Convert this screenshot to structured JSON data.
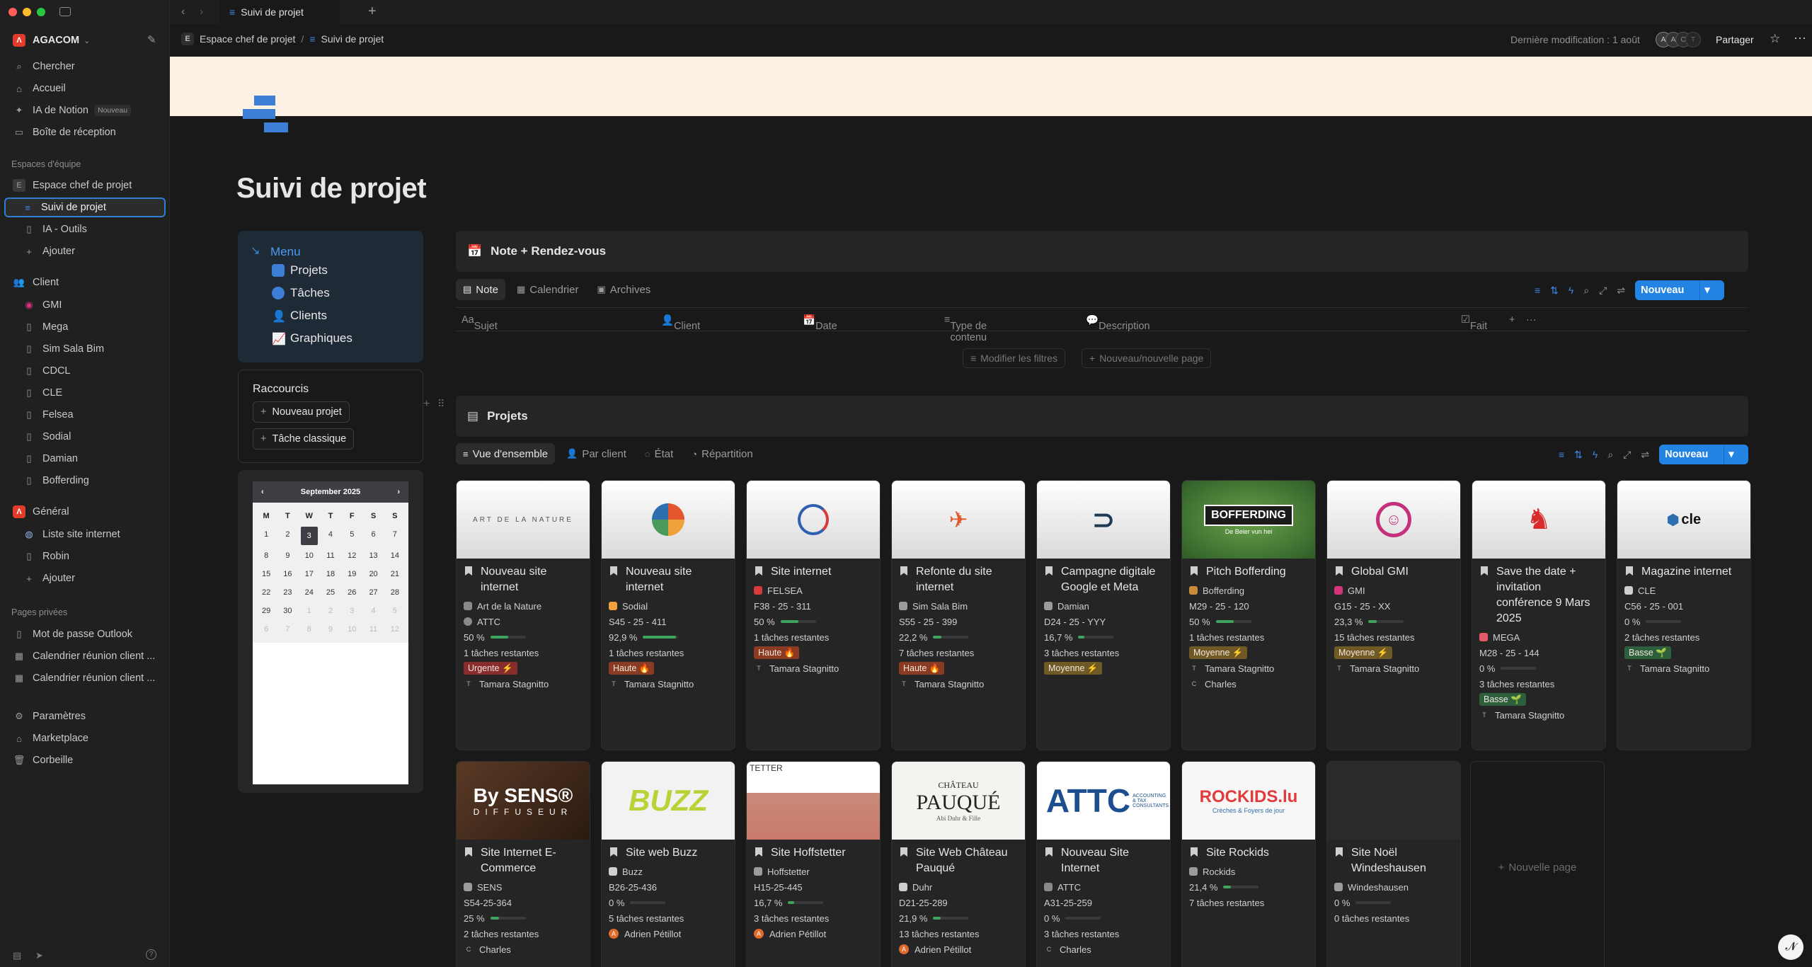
{
  "window": {
    "tab_title": "Suivi de projet"
  },
  "workspace": {
    "name": "AGACOM"
  },
  "sidebar": {
    "top": [
      {
        "label": "Chercher",
        "icon": "search-icon"
      },
      {
        "label": "Accueil",
        "icon": "home-icon"
      },
      {
        "label": "IA de Notion",
        "icon": "ai-icon",
        "badge": "Nouveau"
      },
      {
        "label": "Boîte de réception",
        "icon": "inbox-icon"
      }
    ],
    "team_section": "Espaces d'équipe",
    "team_space": "Espace chef de projet",
    "team_items": [
      "Suivi de projet",
      "IA - Outils",
      "Ajouter"
    ],
    "client_section": "Client",
    "client_items": [
      "GMI",
      "Mega",
      "Sim Sala Bim",
      "CDCL",
      "CLE",
      "Felsea",
      "Sodial",
      "Damian",
      "Bofferding"
    ],
    "general_section": "Général",
    "general_items": [
      "Liste site internet",
      "Robin",
      "Ajouter"
    ],
    "private_section": "Pages privées",
    "private_items": [
      "Mot de passe Outlook",
      "Calendrier réunion client ...",
      "Calendrier réunion client ..."
    ],
    "bottom": [
      "Paramètres",
      "Marketplace",
      "Corbeille"
    ]
  },
  "breadcrumb": {
    "space": "Espace chef de projet",
    "sep": "/",
    "page": "Suivi de projet",
    "space_initial": "E"
  },
  "header": {
    "last_modified": "Dernière modification : 1 août",
    "share": "Partager"
  },
  "page": {
    "title": "Suivi de projet"
  },
  "menu": {
    "heading": "Menu",
    "items": [
      "Projets",
      "Tâches",
      "Clients",
      "Graphiques"
    ]
  },
  "shortcuts": {
    "heading": "Raccourcis",
    "buttons": [
      "Nouveau projet",
      "Tâche classique"
    ]
  },
  "calendar": {
    "month": "September 2025",
    "dow": [
      "M",
      "T",
      "W",
      "T",
      "F",
      "S",
      "S"
    ],
    "days": [
      "1",
      "2",
      "3",
      "4",
      "5",
      "6",
      "7",
      "8",
      "9",
      "10",
      "11",
      "12",
      "13",
      "14",
      "15",
      "16",
      "17",
      "18",
      "19",
      "20",
      "21",
      "22",
      "23",
      "24",
      "25",
      "26",
      "27",
      "28",
      "29",
      "30",
      "1",
      "2",
      "3",
      "4",
      "5",
      "6",
      "7",
      "8",
      "9",
      "10",
      "11",
      "12"
    ],
    "today": "3"
  },
  "notes_db": {
    "title": "Note + Rendez-vous",
    "tabs": [
      "Note",
      "Calendrier",
      "Archives"
    ],
    "new_label": "Nouveau",
    "columns": [
      "Sujet",
      "Client",
      "Date",
      "Type de contenu",
      "Description",
      "Fait"
    ],
    "empty_actions": [
      "Modifier les filtres",
      "Nouveau/nouvelle page"
    ]
  },
  "projects_db": {
    "title": "Projets",
    "tabs": [
      "Vue d'ensemble",
      "Par client",
      "État",
      "Répartition"
    ],
    "new_label": "Nouveau",
    "new_page": "Nouvelle page"
  },
  "cards": [
    {
      "title": "Nouveau site internet",
      "client": "Art de la Nature",
      "client2": "ATTC",
      "code": "",
      "progress": "50 %",
      "pct": 0.5,
      "tasks": "1 tâches restantes",
      "priority": "Urgente ⚡",
      "prio_class": "urgente",
      "people": [
        "Tamara Stagnitto"
      ],
      "img": "ART DE LA NATURE"
    },
    {
      "title": "Nouveau site internet",
      "client": "Sodial",
      "code": "S45 - 25 - 411",
      "progress": "92,9 %",
      "pct": 0.929,
      "tasks": "1 tâches restantes",
      "priority": "Haute 🔥",
      "prio_class": "haute",
      "people": [
        "Tamara Stagnitto"
      ],
      "img": ""
    },
    {
      "title": "Site internet",
      "client": "FELSEA",
      "code": "F38 - 25 - 311",
      "progress": "50 %",
      "pct": 0.5,
      "tasks": "1 tâches restantes",
      "priority": "Haute 🔥",
      "prio_class": "haute",
      "people": [
        "Tamara Stagnitto"
      ],
      "img": ""
    },
    {
      "title": "Refonte du site internet",
      "client": "Sim Sala Bim",
      "code": "S55 - 25 - 399",
      "progress": "22,2 %",
      "pct": 0.222,
      "tasks": "7 tâches restantes",
      "priority": "Haute 🔥",
      "prio_class": "haute",
      "people": [
        "Tamara Stagnitto"
      ],
      "img": ""
    },
    {
      "title": "Campagne digitale Google et Meta",
      "client": "Damian",
      "code": "D24 - 25 - YYY",
      "progress": "16,7 %",
      "pct": 0.167,
      "tasks": "3 tâches restantes",
      "priority": "Moyenne ⚡",
      "prio_class": "moyenne",
      "people": [],
      "img": ""
    },
    {
      "title": "Pitch Bofferding",
      "client": "Bofferding",
      "code": "M29 - 25 - 120",
      "progress": "50 %",
      "pct": 0.5,
      "tasks": "1 tâches restantes",
      "priority": "Moyenne ⚡",
      "prio_class": "moyenne",
      "people": [
        "Tamara Stagnitto",
        "Charles"
      ],
      "img": "BOFFERDING"
    },
    {
      "title": "Global GMI",
      "client": "GMI",
      "code": "G15 - 25 - XX",
      "progress": "23,3 %",
      "pct": 0.233,
      "tasks": "15 tâches restantes",
      "priority": "Moyenne ⚡",
      "prio_class": "moyenne",
      "people": [
        "Tamara Stagnitto"
      ],
      "img": ""
    },
    {
      "title": "Save the date + invitation conférence 9 Mars 2025",
      "client": "MEGA",
      "code": "M28 - 25 - 144",
      "progress": "0 %",
      "pct": 0,
      "tasks": "3 tâches restantes",
      "priority": "Basse 🌱",
      "prio_class": "basse",
      "people": [
        "Tamara Stagnitto"
      ],
      "img": ""
    },
    {
      "title": "Magazine internet",
      "client": "CLE",
      "code": "C56 - 25 - 001",
      "progress": "0 %",
      "pct": 0,
      "tasks": "2 tâches restantes",
      "priority": "Basse 🌱",
      "prio_class": "basse",
      "people": [
        "Tamara Stagnitto"
      ],
      "img": "cle"
    },
    {
      "title": "Site Internet E-Commerce",
      "client": "SENS",
      "code": "S54-25-364",
      "progress": "25 %",
      "pct": 0.25,
      "tasks": "2 tâches restantes",
      "priority": "",
      "people": [
        "Charles"
      ],
      "img": "By SENS®"
    },
    {
      "title": "Site web Buzz",
      "client": "Buzz",
      "code": "B26-25-436",
      "progress": "0 %",
      "pct": 0,
      "tasks": "5 tâches restantes",
      "priority": "",
      "people": [
        "Adrien Pétillot"
      ],
      "img": "BUZZ"
    },
    {
      "title": "Site Hoffstetter",
      "client": "Hoffstetter",
      "code": "H15-25-445",
      "progress": "16,7 %",
      "pct": 0.167,
      "tasks": "3 tâches restantes",
      "priority": "",
      "people": [
        "Adrien Pétillot"
      ],
      "img": "TETTER"
    },
    {
      "title": "Site Web Château Pauqué",
      "client": "Duhr",
      "code": "D21-25-289",
      "progress": "21,9 %",
      "pct": 0.219,
      "tasks": "13 tâches restantes",
      "priority": "",
      "people": [
        "Adrien Pétillot"
      ],
      "img": "PAUQUÉ"
    },
    {
      "title": "Nouveau Site Internet",
      "client": "ATTC",
      "code": "A31-25-259",
      "progress": "0 %",
      "pct": 0,
      "tasks": "3 tâches restantes",
      "priority": "",
      "people": [
        "Charles"
      ],
      "img": "ATTC"
    },
    {
      "title": "Site Rockids",
      "client": "Rockids",
      "code": "",
      "progress": "21,4 %",
      "pct": 0.214,
      "tasks": "7 tâches restantes",
      "priority": "",
      "people": [],
      "img": "ROCKIDS.lu"
    },
    {
      "title": "Site Noël Windeshausen",
      "client": "Windeshausen",
      "code": "",
      "progress": "0 %",
      "pct": 0,
      "tasks": "0 tâches restantes",
      "priority": "",
      "people": [],
      "img": ""
    }
  ],
  "image_texts": {
    "adln": "ART DE LA NATURE",
    "boff": "BOFFERDING",
    "boff_sub": "De Beier vun hei",
    "cle": "cle",
    "sens": "By SENS®",
    "sens_sub": "DIFFUSEUR",
    "buzz": "BUZZ",
    "hoff": "TETTER",
    "chateau": "CHÂTEAU",
    "pauque": "PAUQUÉ",
    "pauque_sub": "Abi Duhr & Fille",
    "attc": "ATTC",
    "attc_sub": "ACCOUNTING & TAX CONSULTANTS",
    "rockids": "ROCKIDS.lu",
    "rockids_sub": "Crèches & Foyers de jour"
  },
  "colors": {
    "accent": "#2383e2",
    "cover": "#fdf1e6",
    "menu_bg": "#1f2a37"
  }
}
